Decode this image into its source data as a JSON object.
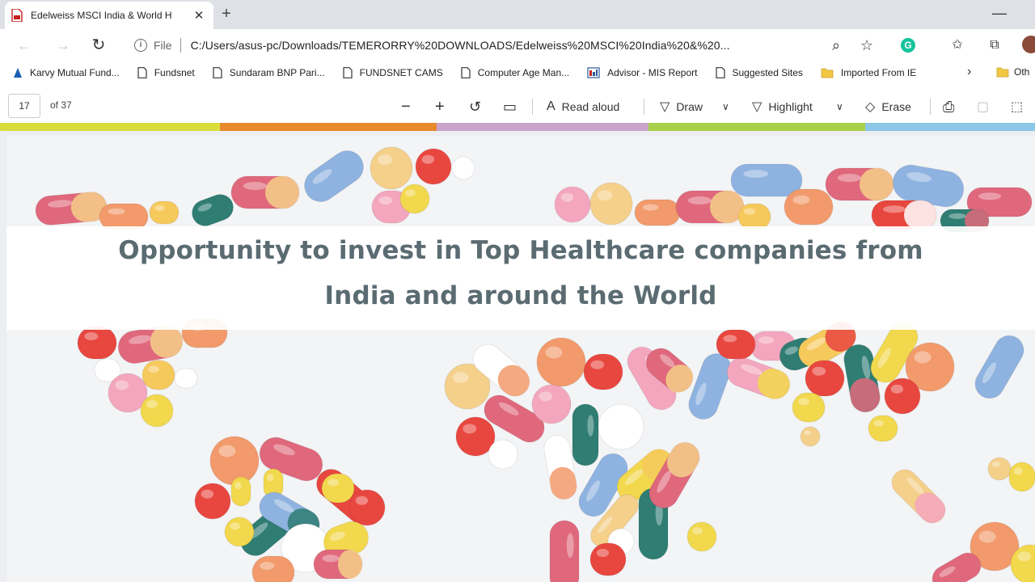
{
  "browser": {
    "tab_title": "Edelweiss MSCI India & World H",
    "tab_close": "✕",
    "new_tab": "+",
    "minimize": "—",
    "scheme_label": "File",
    "url": "C:/Users/asus-pc/Downloads/TEMERORRY%20DOWNLOADS/Edelweiss%20MSCI%20India%20&%20...",
    "nav": {
      "back": "←",
      "forward": "→",
      "reload": "↻"
    },
    "icons": {
      "search": "⌕",
      "favorite": "☆",
      "grammarly": "G",
      "collections": "✩",
      "extensions": "⧉"
    }
  },
  "bookmarks": {
    "items": [
      {
        "label": "Karvy Mutual Fund...",
        "icon": "karvy-icon"
      },
      {
        "label": "Fundsnet",
        "icon": "page-icon"
      },
      {
        "label": "Sundaram BNP Pari...",
        "icon": "page-icon"
      },
      {
        "label": "FUNDSNET CAMS",
        "icon": "page-icon"
      },
      {
        "label": "Computer Age Man...",
        "icon": "page-icon"
      },
      {
        "label": "Advisor - MIS Report",
        "icon": "report-icon"
      },
      {
        "label": "Suggested Sites",
        "icon": "page-icon"
      },
      {
        "label": "Imported From IE",
        "icon": "folder-icon"
      }
    ],
    "more": "›",
    "other_label": "Oth"
  },
  "pdf_toolbar": {
    "page_current": "17",
    "page_total": "of 37",
    "zoom_out": "−",
    "zoom_in": "+",
    "rotate": "↺",
    "fit": "▭",
    "read_aloud": "Read aloud",
    "draw": "Draw",
    "highlight": "Highlight",
    "erase": "Erase",
    "print": "⎙",
    "save": "▢",
    "save_as": "⬚"
  },
  "pdf_page": {
    "headline_line1": "Opportunity to invest in Top Healthcare companies from",
    "headline_line2": "India and around the World"
  },
  "colors": {
    "tab_strip": "#dee1e6",
    "page_background": "#f3f4f6",
    "headline_text": "#5b6b72",
    "accent_stripe": [
      "#d9dd3c",
      "#e88a2c",
      "#c9a3c9",
      "#a8d04a",
      "#8cc7e6"
    ],
    "pill_colors": [
      "#e0687c",
      "#f29a6b",
      "#f6c95c",
      "#f4d08a",
      "#8fb3e0",
      "#e8473f",
      "#f3a6bd",
      "#2f7d73",
      "#ffffff",
      "#f2d84d"
    ]
  }
}
